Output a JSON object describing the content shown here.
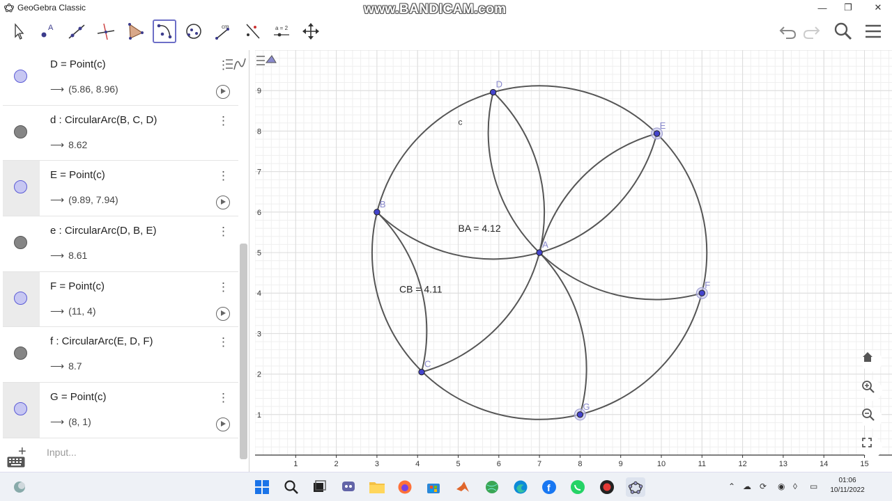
{
  "window": {
    "title": "GeoGebra Classic",
    "watermark": "www.BANDICAM.com",
    "controls": [
      "minimize",
      "maximize",
      "close"
    ]
  },
  "toolbar": {
    "tools": [
      {
        "id": "move",
        "icon": "move-arrow-icon"
      },
      {
        "id": "point",
        "icon": "point-icon",
        "label": "A"
      },
      {
        "id": "line",
        "icon": "line-icon"
      },
      {
        "id": "perpendicular",
        "icon": "perpendicular-line-icon"
      },
      {
        "id": "polygon",
        "icon": "polygon-icon"
      },
      {
        "id": "circular-arc",
        "icon": "circular-arc-icon",
        "active": true
      },
      {
        "id": "circle",
        "icon": "circle-icon"
      },
      {
        "id": "distance",
        "icon": "distance-icon",
        "label": "cm"
      },
      {
        "id": "reflect",
        "icon": "reflect-icon"
      },
      {
        "id": "slider",
        "icon": "slider-icon",
        "label": "a = 2"
      },
      {
        "id": "move-view",
        "icon": "move-graphics-view-icon"
      }
    ],
    "right": [
      "undo-icon",
      "redo-icon",
      "search-icon",
      "menu-icon"
    ]
  },
  "algebra": {
    "rows": [
      {
        "kind": "point",
        "definition": "D = Point(c)",
        "value": "(5.86, 8.96)",
        "highlight": false,
        "play": true
      },
      {
        "kind": "arc",
        "definition": "d : CircularArc(B, C, D)",
        "value": "8.62",
        "highlight": false,
        "play": false
      },
      {
        "kind": "point",
        "definition": "E = Point(c)",
        "value": "(9.89, 7.94)",
        "highlight": true,
        "play": true
      },
      {
        "kind": "arc",
        "definition": "e : CircularArc(D, B, E)",
        "value": "8.61",
        "highlight": false,
        "play": false
      },
      {
        "kind": "point",
        "definition": "F = Point(c)",
        "value": "(11, 4)",
        "highlight": true,
        "play": true
      },
      {
        "kind": "arc",
        "definition": "f : CircularArc(E, D, F)",
        "value": "8.7",
        "highlight": false,
        "play": false
      },
      {
        "kind": "point",
        "definition": "G = Point(c)",
        "value": "(8, 1)",
        "highlight": true,
        "play": true
      }
    ],
    "input_placeholder": "Input..."
  },
  "graphics": {
    "x_ticks": [
      "1",
      "2",
      "3",
      "4",
      "5",
      "6",
      "7",
      "8",
      "9",
      "10",
      "11",
      "12",
      "13",
      "14",
      "15"
    ],
    "y_ticks": [
      "1",
      "2",
      "3",
      "4",
      "5",
      "6",
      "7",
      "8",
      "9"
    ],
    "circle": {
      "label": "c",
      "center": [
        7,
        5
      ],
      "radius": 4.12
    },
    "points": [
      {
        "name": "A",
        "x": 7,
        "y": 5
      },
      {
        "name": "B",
        "x": 3,
        "y": 6
      },
      {
        "name": "C",
        "x": 4.1,
        "y": 2.05
      },
      {
        "name": "D",
        "x": 5.86,
        "y": 8.96
      },
      {
        "name": "E",
        "x": 9.89,
        "y": 7.94
      },
      {
        "name": "F",
        "x": 11,
        "y": 4
      },
      {
        "name": "G",
        "x": 8,
        "y": 1
      }
    ],
    "texts": [
      {
        "text": "BA = 4.12",
        "x": 5,
        "y": 5.6
      },
      {
        "text": "CB = 4.11",
        "x": 3.55,
        "y": 4.1
      }
    ],
    "colors": {
      "curve": "#555555",
      "point": "#4444cc",
      "label": "#8888cc",
      "grid_major": "#dcdcdc",
      "grid_minor": "#efefef"
    }
  },
  "taskbar": {
    "apps": [
      "windows-start-icon",
      "search-icon",
      "task-view-icon",
      "chat-icon",
      "file-explorer-icon",
      "firefox-icon",
      "store-icon",
      "matlab-icon",
      "globe-icon",
      "edge-icon",
      "facebook-icon",
      "whatsapp-icon",
      "record-icon",
      "geogebra-icon"
    ],
    "clock_time": "01:06",
    "clock_date": "10/11/2022"
  }
}
